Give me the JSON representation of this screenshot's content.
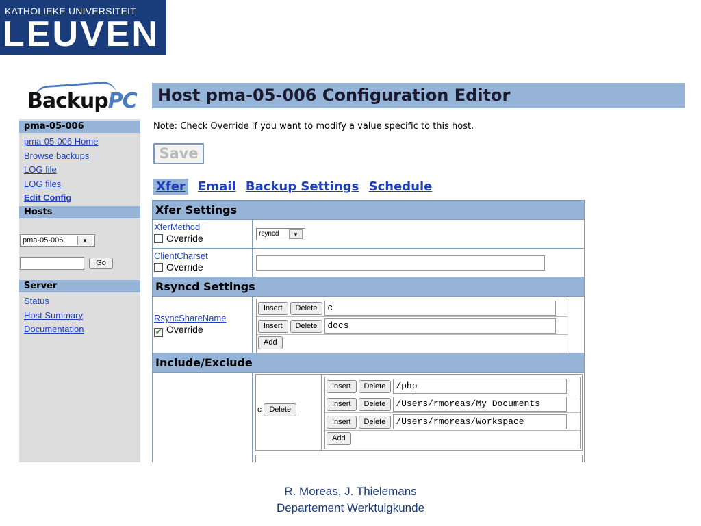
{
  "slide": {
    "logo_top": "KATHOLIEKE UNIVERSITEIT",
    "logo_big": "LEUVEN",
    "footer_line1": "R. Moreas, J. Thielemans",
    "footer_line2": "Departement Werktuigkunde"
  },
  "sidebar": {
    "logo_text_a": "Backup",
    "logo_text_b": "PC",
    "host_header": "pma-05-006",
    "host_links": [
      "pma-05-006 Home",
      "Browse backups",
      "LOG file",
      "LOG files",
      "Edit Config"
    ],
    "hosts_header": "Hosts",
    "host_select_value": "pma-05-006",
    "go_label": "Go",
    "server_header": "Server",
    "server_links": [
      "Status",
      "Host Summary",
      "Documentation"
    ]
  },
  "main": {
    "title": "Host pma-05-006 Configuration Editor",
    "note": "Note: Check Override if you want to modify a value specific to this host.",
    "save_label": "Save",
    "tabs": [
      "Xfer",
      "Email",
      "Backup Settings",
      "Schedule"
    ],
    "active_tab": "Xfer"
  },
  "config": {
    "xfer_section": "Xfer Settings",
    "xfer_method_label": "XferMethod",
    "xfer_method_value": "rsyncd",
    "client_charset_label": "ClientCharset",
    "client_charset_value": "",
    "override_label": "Override",
    "rsyncd_section": "Rsyncd Settings",
    "rsync_share_label": "RsyncShareName",
    "rsync_shares": [
      "c",
      "docs"
    ],
    "include_section": "Include/Exclude",
    "include_key": "c",
    "include_paths": [
      "/php",
      "/Users/rmoreas/My Documents",
      "/Users/rmoreas/Workspace"
    ],
    "insert_label": "Insert",
    "delete_label": "Delete",
    "add_label": "Add"
  }
}
